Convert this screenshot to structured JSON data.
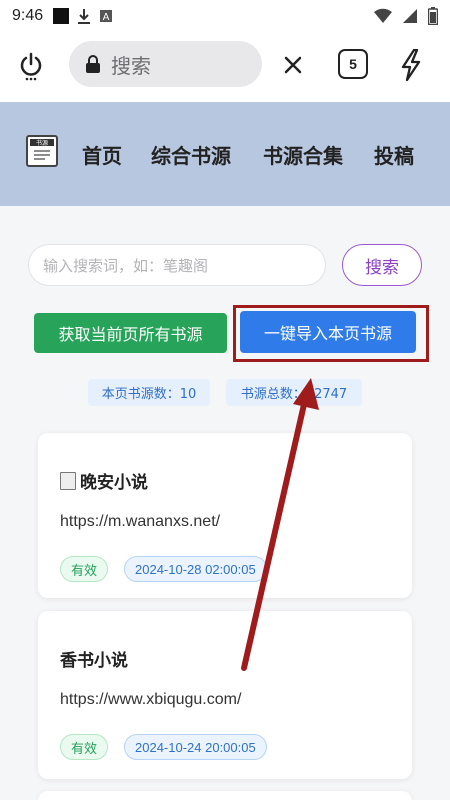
{
  "status_bar": {
    "time": "9:46"
  },
  "browser": {
    "search_placeholder": "搜索",
    "tab_count": "5",
    "icons": [
      "power-icon",
      "lock-icon",
      "close-icon",
      "tabs-icon",
      "bolt-icon"
    ]
  },
  "site": {
    "logo_text": "书源",
    "nav": [
      "首页",
      "综合书源",
      "书源合集",
      "投稿"
    ]
  },
  "search": {
    "placeholder": "输入搜索词，如：笔趣阁",
    "button_label": "搜索"
  },
  "actions": {
    "get_all_label": "获取当前页所有书源",
    "import_label": "一键导入本页书源"
  },
  "stats": {
    "page_count_label": "本页书源数：10",
    "total_label": "书源总数：22747"
  },
  "cards": [
    {
      "title": "晚安小说",
      "url": "https://m.wananxs.net/",
      "status": "有效",
      "date": "2024-10-28 02:00:05"
    },
    {
      "title": "香书小说",
      "url": "https://www.xbiqugu.com/",
      "status": "有效",
      "date": "2024-10-24 20:00:05"
    }
  ],
  "colors": {
    "nav_bg": "#b8c7e0",
    "green_button": "#27a45a",
    "blue_button": "#2f7bea",
    "highlight_border": "#a01c1c",
    "arrow": "#a01c1c",
    "search_accent": "#8a3fc6"
  }
}
